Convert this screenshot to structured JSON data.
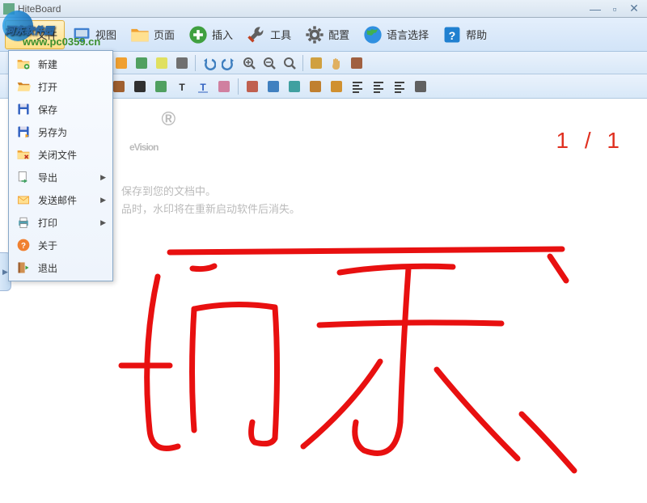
{
  "window": {
    "title": "HiteBoard"
  },
  "menubar": [
    {
      "id": "file",
      "label": "文件",
      "icon": "folder",
      "active": true
    },
    {
      "id": "view",
      "label": "视图",
      "icon": "monitor"
    },
    {
      "id": "page",
      "label": "页面",
      "icon": "page"
    },
    {
      "id": "insert",
      "label": "插入",
      "icon": "plus"
    },
    {
      "id": "tools",
      "label": "工具",
      "icon": "wrench"
    },
    {
      "id": "config",
      "label": "配置",
      "icon": "gear"
    },
    {
      "id": "lang",
      "label": "语言选择",
      "icon": "globe"
    },
    {
      "id": "help",
      "label": "帮助",
      "icon": "question"
    }
  ],
  "file_menu": [
    {
      "id": "new",
      "label": "新建",
      "icon": "folder-new",
      "sub": false
    },
    {
      "id": "open",
      "label": "打开",
      "icon": "folder-open",
      "sub": false
    },
    {
      "id": "save",
      "label": "保存",
      "icon": "disk",
      "sub": false
    },
    {
      "id": "saveas",
      "label": "另存为",
      "icon": "disk-as",
      "sub": false
    },
    {
      "id": "close",
      "label": "关闭文件",
      "icon": "folder-close",
      "sub": false
    },
    {
      "id": "export",
      "label": "导出",
      "icon": "export",
      "sub": true
    },
    {
      "id": "sendmail",
      "label": "发送邮件",
      "icon": "mail",
      "sub": true
    },
    {
      "id": "print",
      "label": "打印",
      "icon": "printer",
      "sub": true
    },
    {
      "id": "about",
      "label": "关于",
      "icon": "help",
      "sub": false
    },
    {
      "id": "exit",
      "label": "退出",
      "icon": "exit",
      "sub": false
    }
  ],
  "toolbar_icons": [
    "new",
    "open",
    "save",
    "page-new",
    "page-del",
    "page-cfg",
    "img",
    "page-b",
    "cam",
    "undo",
    "redo",
    "zoom-in",
    "zoom-out",
    "zoom-reset",
    "select",
    "hand",
    "trash"
  ],
  "tooltray_icons": [
    "pointer",
    "marker",
    "brush1",
    "brush2",
    "brush3",
    "stamp",
    "clapper",
    "picture",
    "text",
    "texta",
    "eraser",
    "sep",
    "palette",
    "color-fill",
    "shape",
    "texture",
    "color-a",
    "align-l",
    "align-c",
    "align-r",
    "camera"
  ],
  "canvas": {
    "watermark_brand": "eVision",
    "watermark_reg": "®",
    "watermark_line1": "保存到您的文档中。",
    "watermark_line2": "品时，水印将在重新启动软件后消失。",
    "page_indicator": "1 / 1"
  },
  "overlay": {
    "site_name": "河东软件园",
    "site_url": "www.pc0359.cn"
  }
}
